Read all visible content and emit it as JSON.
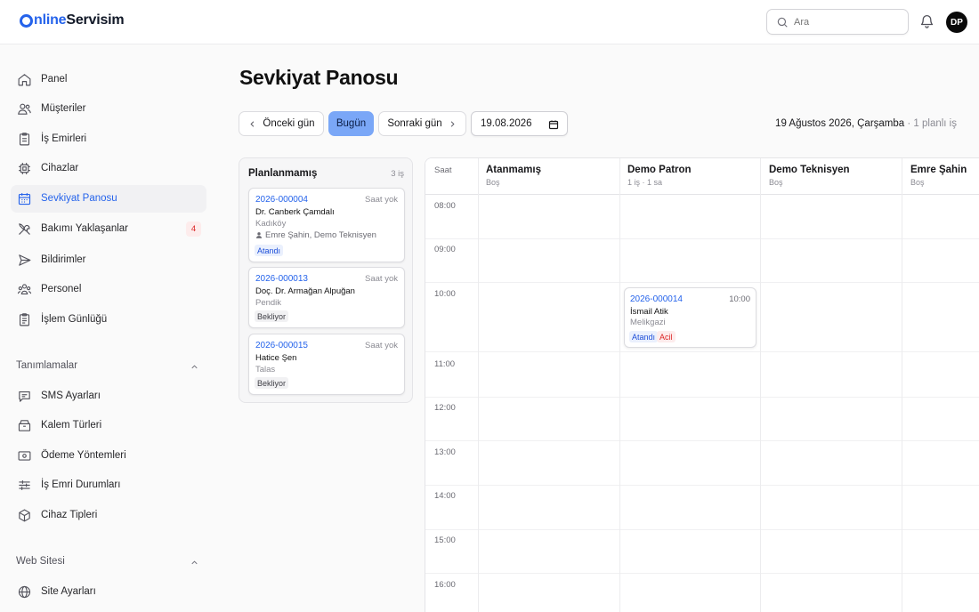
{
  "brand": {
    "logo_letter": "",
    "logo_blue": "nline",
    "logo_dark": "Servisim",
    "accent": "#2563eb"
  },
  "header": {
    "search_placeholder": "Ara",
    "user_initials": "DP"
  },
  "sidebar": {
    "items": [
      {
        "label": "Panel",
        "icon": "home-icon"
      },
      {
        "label": "Müşteriler",
        "icon": "users-icon"
      },
      {
        "label": "İş Emirleri",
        "icon": "clipboard-icon"
      },
      {
        "label": "Cihazlar",
        "icon": "chip-icon"
      },
      {
        "label": "Sevkiyat Panosu",
        "icon": "calendar-icon",
        "active": true
      },
      {
        "label": "Bakımı Yaklaşanlar",
        "icon": "wrench-icon",
        "badge": "4"
      },
      {
        "label": "Bildirimler",
        "icon": "send-icon"
      },
      {
        "label": "Personel",
        "icon": "team-icon"
      },
      {
        "label": "İşlem Günlüğü",
        "icon": "log-icon"
      }
    ],
    "section_definitions": "Tanımlamalar",
    "definitions": [
      {
        "label": "SMS Ayarları",
        "icon": "message-icon"
      },
      {
        "label": "Kalem Türleri",
        "icon": "box-icon"
      },
      {
        "label": "Ödeme Yöntemleri",
        "icon": "payment-icon"
      },
      {
        "label": "İş Emri Durumları",
        "icon": "sliders-icon"
      },
      {
        "label": "Cihaz Tipleri",
        "icon": "cube-icon"
      }
    ],
    "section_website": "Web Sitesi",
    "website": [
      {
        "label": "Site Ayarları",
        "icon": "globe-icon"
      }
    ]
  },
  "main": {
    "title": "Sevkiyat Panosu",
    "prev_day": "Önceki gün",
    "today": "Bugün",
    "next_day": "Sonraki gün",
    "date_value": "19.08.2026",
    "date_long": "19 Ağustos 2026, Çarşamba",
    "date_separator": " · ",
    "planned_count": "1 planlı iş"
  },
  "unplanned": {
    "title": "Planlanmamış",
    "count": "3 iş",
    "cards": [
      {
        "no": "2026-000004",
        "time": "Saat yok",
        "name": "Dr. Canberk Çamdalı",
        "location": "Kadıköy",
        "technicians": "Emre Şahin, Demo Teknisyen",
        "status": "Atandı",
        "status_type": "assigned"
      },
      {
        "no": "2026-000013",
        "time": "Saat yok",
        "name": "Doç. Dr. Armağan Alpuğan",
        "location": "Pendik",
        "status": "Bekliyor",
        "status_type": "waiting"
      },
      {
        "no": "2026-000015",
        "time": "Saat yok",
        "name": "Hatice Şen",
        "location": "Talas",
        "status": "Bekliyor",
        "status_type": "waiting"
      }
    ]
  },
  "calendar": {
    "time_header": "Saat",
    "columns": [
      {
        "name": "Atanmamış",
        "sub": "Boş"
      },
      {
        "name": "Demo Patron",
        "sub": "1 iş · 1 sa"
      },
      {
        "name": "Demo Teknisyen",
        "sub": "Boş"
      },
      {
        "name": "Emre Şahin",
        "sub": "Boş"
      }
    ],
    "hours": [
      "08:00",
      "09:00",
      "10:00",
      "11:00",
      "12:00",
      "13:00",
      "14:00",
      "15:00",
      "16:00"
    ],
    "event": {
      "no": "2026-000014",
      "time": "10:00",
      "name": "İsmail Atik",
      "location": "Melikgazi",
      "status": "Atandı",
      "priority": "Acil"
    }
  }
}
